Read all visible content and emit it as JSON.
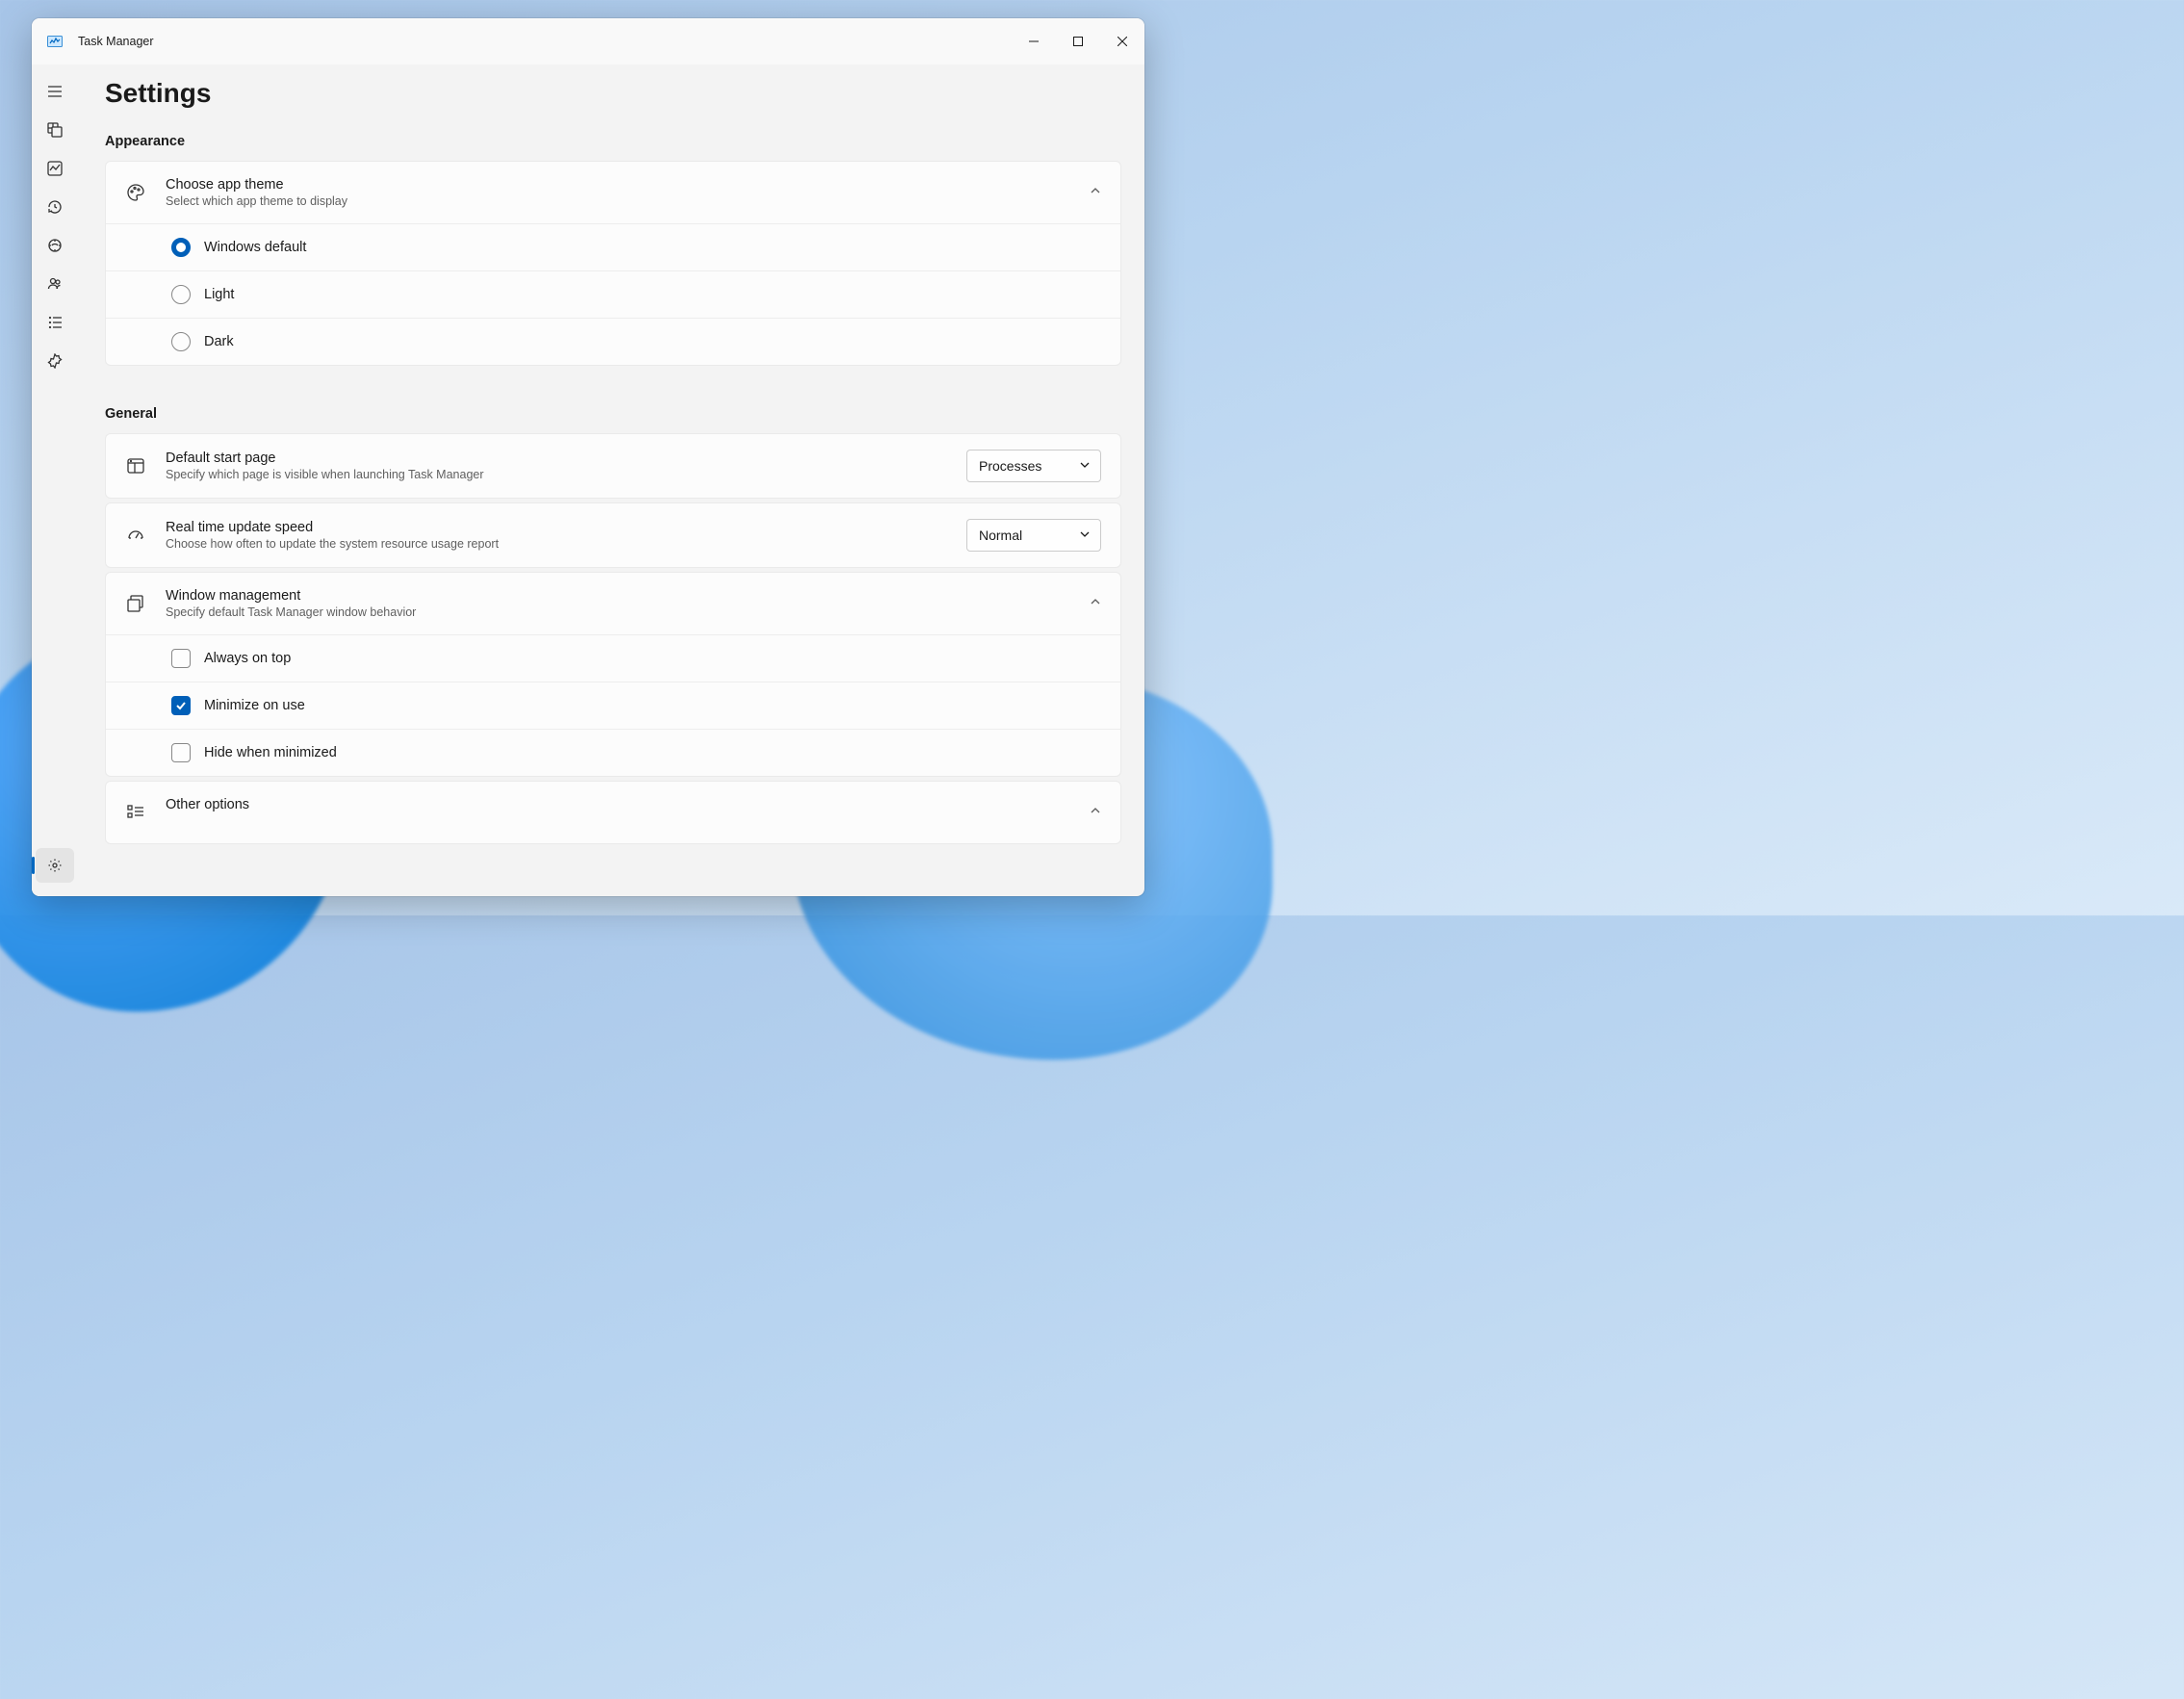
{
  "window": {
    "title": "Task Manager"
  },
  "page": {
    "title": "Settings"
  },
  "sections": {
    "appearance": {
      "label": "Appearance",
      "theme": {
        "title": "Choose app theme",
        "subtitle": "Select which app theme to display",
        "options": {
          "default": "Windows default",
          "light": "Light",
          "dark": "Dark"
        },
        "selected": "default"
      }
    },
    "general": {
      "label": "General",
      "startPage": {
        "title": "Default start page",
        "subtitle": "Specify which page is visible when launching Task Manager",
        "value": "Processes"
      },
      "updateSpeed": {
        "title": "Real time update speed",
        "subtitle": "Choose how often to update the system resource usage report",
        "value": "Normal"
      },
      "windowManagement": {
        "title": "Window management",
        "subtitle": "Specify default Task Manager window behavior",
        "options": {
          "alwaysOnTop": {
            "label": "Always on top",
            "checked": false
          },
          "minimizeOnUse": {
            "label": "Minimize on use",
            "checked": true
          },
          "hideWhenMinimized": {
            "label": "Hide when minimized",
            "checked": false
          }
        }
      },
      "otherOptions": {
        "title": "Other options"
      }
    }
  }
}
